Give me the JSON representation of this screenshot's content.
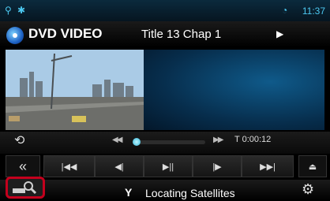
{
  "status_bar": {
    "icons": [
      "location-pin-icon",
      "bluetooth-icon",
      "wifi-icon"
    ],
    "time": "11:37"
  },
  "header": {
    "source": "DVD VIDEO",
    "track_info": "Title 13 Chap  1",
    "play_state_icon": "play-indicator-icon"
  },
  "playback": {
    "elapsed_time": "T 0:00:12",
    "progress": 0.05
  },
  "controls": {
    "icons": [
      "collapse-panel-icon",
      "skip-previous-icon",
      "step-back-icon",
      "play-pause-icon",
      "step-forward-icon",
      "skip-next-icon",
      "eject-icon"
    ]
  },
  "bottom_bar": {
    "navigation_status": "Locating Satellites"
  },
  "colors": {
    "accent": "#4cc8f0",
    "highlight": "#c4001d"
  }
}
